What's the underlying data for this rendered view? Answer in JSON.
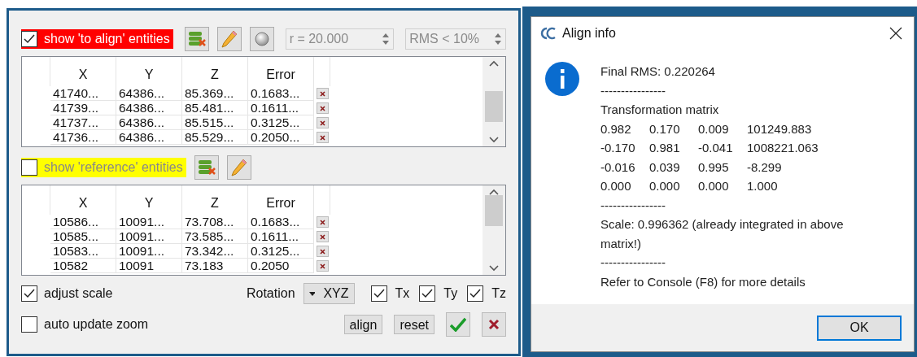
{
  "align_panel": {
    "to_align": {
      "label": "show 'to align' entities",
      "checked": true
    },
    "radius": "r = 20.000",
    "rms_filter": "RMS < 10%",
    "to_align_table": {
      "columns": [
        "X",
        "Y",
        "Z",
        "Error"
      ],
      "rows": [
        [
          "41740...",
          "64386...",
          "85.369...",
          "0.1683..."
        ],
        [
          "41739...",
          "64386...",
          "85.481...",
          "0.1611..."
        ],
        [
          "41737...",
          "64386...",
          "85.515...",
          "0.3125..."
        ],
        [
          "41736...",
          "64386...",
          "85.529...",
          "0.2050..."
        ]
      ]
    },
    "reference": {
      "label": "show 'reference' entities",
      "checked": false
    },
    "reference_table": {
      "columns": [
        "X",
        "Y",
        "Z",
        "Error"
      ],
      "rows": [
        [
          "10586...",
          "10091...",
          "73.708...",
          "0.1683..."
        ],
        [
          "10585...",
          "10091...",
          "73.585...",
          "0.1611..."
        ],
        [
          "10583...",
          "10091...",
          "73.342...",
          "0.3125..."
        ],
        [
          "10582",
          "10091",
          "73.183",
          "0.2050"
        ]
      ]
    },
    "adjust_scale": {
      "label": "adjust scale",
      "checked": true
    },
    "rotation": {
      "label": "Rotation",
      "value": "XYZ"
    },
    "translations": [
      {
        "label": "Tx",
        "checked": true
      },
      {
        "label": "Ty",
        "checked": true
      },
      {
        "label": "Tz",
        "checked": true
      }
    ],
    "auto_update_zoom": {
      "label": "auto update zoom",
      "checked": false
    },
    "buttons": [
      "align",
      "reset"
    ]
  },
  "dialog": {
    "title": "Align info",
    "message": [
      {
        "kind": "text",
        "text": "Final RMS: 0.220264"
      },
      {
        "kind": "text",
        "text": "----------------"
      },
      {
        "kind": "text",
        "text": "Transformation matrix"
      },
      {
        "kind": "matrix",
        "rows": [
          [
            "0.982",
            "0.170",
            "0.009",
            "101249.883"
          ],
          [
            "-0.170",
            "0.981",
            "-0.041",
            "1008221.063"
          ],
          [
            "-0.016",
            "0.039",
            "0.995",
            "-8.299"
          ],
          [
            "0.000",
            "0.000",
            "0.000",
            "1.000"
          ]
        ]
      },
      {
        "kind": "text",
        "text": "----------------"
      },
      {
        "kind": "text",
        "text": "Scale: 0.996362 (already integrated in above matrix!)"
      },
      {
        "kind": "text",
        "text": "----------------"
      },
      {
        "kind": "text",
        "text": "Refer to Console (F8) for more details"
      }
    ],
    "ok": "OK"
  }
}
